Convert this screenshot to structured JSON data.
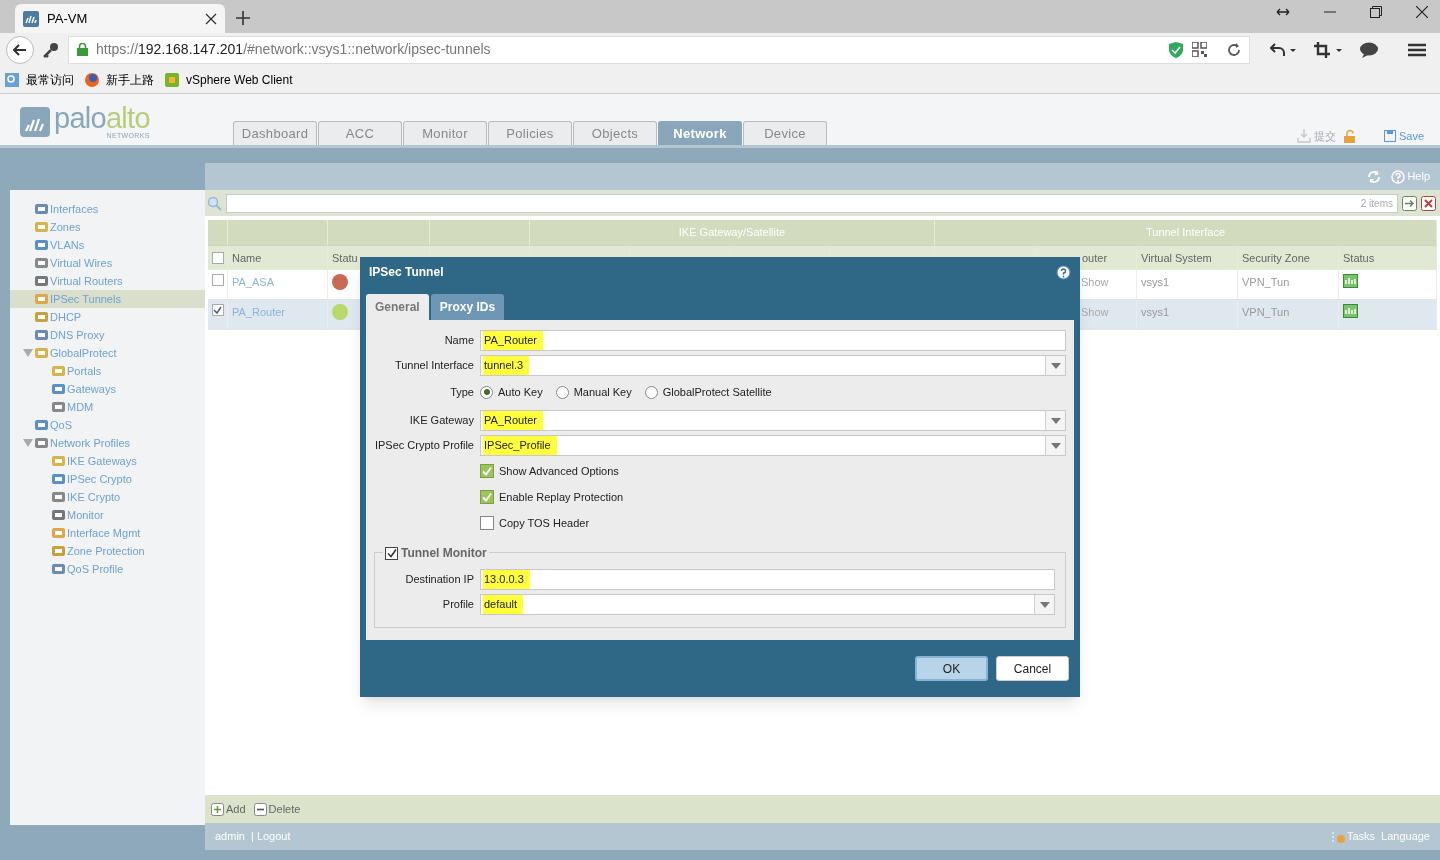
{
  "browser": {
    "tab_title": "PA-VM",
    "url_host": "https://",
    "url_main": "192.168.147.201",
    "url_rest": "/#network::vsys1::network/ipsec-tunnels",
    "bookmarks": [
      "最常访问",
      "新手上路",
      "vSphere Web Client"
    ]
  },
  "header": {
    "logo_main": "palo",
    "logo_accent": "alto",
    "logo_sub": "NETWORKS",
    "tabs": [
      {
        "label": "Dashboard",
        "selected": false
      },
      {
        "label": "ACC",
        "selected": false
      },
      {
        "label": "Monitor",
        "selected": false
      },
      {
        "label": "Policies",
        "selected": false
      },
      {
        "label": "Objects",
        "selected": false
      },
      {
        "label": "Network",
        "selected": true
      },
      {
        "label": "Device",
        "selected": false
      }
    ],
    "actions": [
      {
        "label": "提交",
        "disabled": true
      },
      {
        "label": "Save",
        "disabled": false
      }
    ]
  },
  "sidebar": {
    "items": [
      {
        "label": "Interfaces",
        "selected": false
      },
      {
        "label": "Zones",
        "selected": false
      },
      {
        "label": "VLANs",
        "selected": false
      },
      {
        "label": "Virtual Wires",
        "selected": false
      },
      {
        "label": "Virtual Routers",
        "selected": false
      },
      {
        "label": "IPSec Tunnels",
        "selected": true
      },
      {
        "label": "DHCP",
        "selected": false
      },
      {
        "label": "DNS Proxy",
        "selected": false
      },
      {
        "label": "GlobalProtect",
        "selected": false,
        "expanded": true,
        "children": [
          {
            "label": "Portals",
            "selected": false
          },
          {
            "label": "Gateways",
            "selected": false
          },
          {
            "label": "MDM",
            "selected": false
          }
        ]
      },
      {
        "label": "QoS",
        "selected": false
      },
      {
        "label": "Network Profiles",
        "selected": false,
        "expanded": true,
        "children": [
          {
            "label": "IKE Gateways",
            "selected": false
          },
          {
            "label": "IPSec Crypto",
            "selected": false
          },
          {
            "label": "IKE Crypto",
            "selected": false
          },
          {
            "label": "Monitor",
            "selected": false
          },
          {
            "label": "Interface Mgmt",
            "selected": false
          },
          {
            "label": "Zone Protection",
            "selected": false
          },
          {
            "label": "QoS Profile",
            "selected": false
          }
        ]
      }
    ]
  },
  "toolbar": {
    "help": "Help",
    "count": "2 items"
  },
  "table": {
    "groups": [
      {
        "label": "IKE Gateway/Satellite"
      },
      {
        "label": "Tunnel Interface"
      }
    ],
    "select_all": false,
    "columns": [
      "Name",
      "Statu",
      "outer",
      "Virtual System",
      "Security Zone",
      "Status"
    ],
    "rows": [
      {
        "name": "PA_ASA",
        "checked": false,
        "selected": false,
        "color": "#c96a55",
        "router": "Show",
        "vsys": "vsys1",
        "zone": "VPN_Tun"
      },
      {
        "name": "PA_Router",
        "checked": true,
        "selected": true,
        "color": "#b8d86a",
        "router": "Show",
        "vsys": "vsys1",
        "zone": "VPN_Tun"
      }
    ]
  },
  "footer": {
    "buttons": [
      "Add",
      "Delete"
    ],
    "user": "admin",
    "logout": "| Logout",
    "right": [
      "Tasks",
      "Language"
    ]
  },
  "dialog": {
    "title": "IPSec Tunnel",
    "tabs": [
      {
        "label": "General",
        "selected": true
      },
      {
        "label": "Proxy IDs",
        "selected": false
      }
    ],
    "fields": [
      {
        "kind": "text",
        "label": "Name",
        "value": "PA_Router"
      },
      {
        "kind": "select",
        "label": "Tunnel Interface",
        "value": "tunnel.3"
      },
      {
        "kind": "radio",
        "label": "Type",
        "options": [
          {
            "label": "Auto Key",
            "selected": true
          },
          {
            "label": "Manual Key",
            "selected": false
          },
          {
            "label": "GlobalProtect Satellite",
            "selected": false
          }
        ]
      },
      {
        "kind": "select",
        "label": "IKE Gateway",
        "value": "PA_Router"
      },
      {
        "kind": "select",
        "label": "IPSec Crypto Profile",
        "value": "IPSec_Profile"
      },
      {
        "kind": "check",
        "label": "Show Advanced Options",
        "checked": true
      },
      {
        "kind": "check",
        "label": "Enable Replay Protection",
        "checked": true
      },
      {
        "kind": "check",
        "label": "Copy TOS Header",
        "checked": false
      }
    ],
    "monitor": {
      "label": "Tunnel Monitor",
      "checked": true,
      "fields": [
        {
          "kind": "text",
          "label": "Destination IP",
          "value": "13.0.0.3"
        },
        {
          "kind": "select",
          "label": "Profile",
          "value": "default"
        }
      ]
    },
    "buttons": [
      {
        "label": "OK",
        "primary": true
      },
      {
        "label": "Cancel",
        "primary": false
      }
    ]
  }
}
